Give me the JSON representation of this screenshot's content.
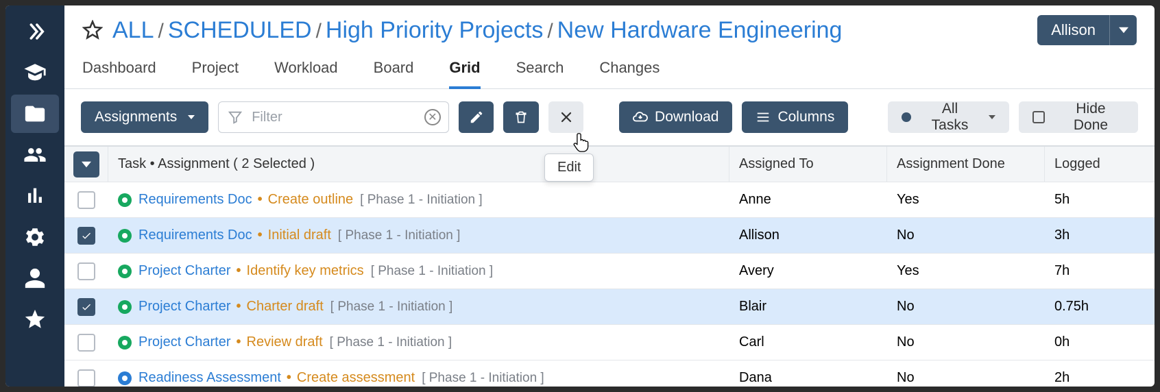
{
  "breadcrumb": {
    "root": "ALL",
    "p1": "SCHEDULED",
    "p2": "High Priority Projects",
    "p3": "New Hardware Engineering"
  },
  "user": {
    "name": "Allison"
  },
  "tabs": {
    "t0": "Dashboard",
    "t1": "Project",
    "t2": "Workload",
    "t3": "Board",
    "t4": "Grid",
    "t5": "Search",
    "t6": "Changes"
  },
  "toolbar": {
    "assignments": "Assignments",
    "filter_placeholder": "Filter",
    "download": "Download",
    "columns": "Columns",
    "alltasks": "All Tasks",
    "hidedone": "Hide Done",
    "edit_tooltip": "Edit"
  },
  "thead": {
    "task": "Task • Assignment ( 2 Selected )",
    "assigned": "Assigned To",
    "done": "Assignment Done",
    "logged": "Logged"
  },
  "rows": [
    {
      "selected": false,
      "status": "green",
      "task": "Requirements Doc",
      "assignment": "Create outline",
      "phase": "[ Phase 1 - Initiation ]",
      "assigned": "Anne",
      "done": "Yes",
      "logged": "5h"
    },
    {
      "selected": true,
      "status": "green",
      "task": "Requirements Doc",
      "assignment": "Initial draft",
      "phase": "[ Phase 1 - Initiation ]",
      "assigned": "Allison",
      "done": "No",
      "logged": "3h"
    },
    {
      "selected": false,
      "status": "green",
      "task": "Project Charter",
      "assignment": "Identify key metrics",
      "phase": "[ Phase 1 - Initiation ]",
      "assigned": "Avery",
      "done": "Yes",
      "logged": "7h"
    },
    {
      "selected": true,
      "status": "green",
      "task": "Project Charter",
      "assignment": "Charter draft",
      "phase": "[ Phase 1 - Initiation ]",
      "assigned": "Blair",
      "done": "No",
      "logged": "0.75h"
    },
    {
      "selected": false,
      "status": "green",
      "task": "Project Charter",
      "assignment": "Review draft",
      "phase": "[ Phase 1 - Initiation ]",
      "assigned": "Carl",
      "done": "No",
      "logged": "0h"
    },
    {
      "selected": false,
      "status": "blue",
      "task": "Readiness Assessment",
      "assignment": "Create assessment",
      "phase": "[ Phase 1 - Initiation ]",
      "assigned": "Dana",
      "done": "No",
      "logged": "2h"
    }
  ]
}
